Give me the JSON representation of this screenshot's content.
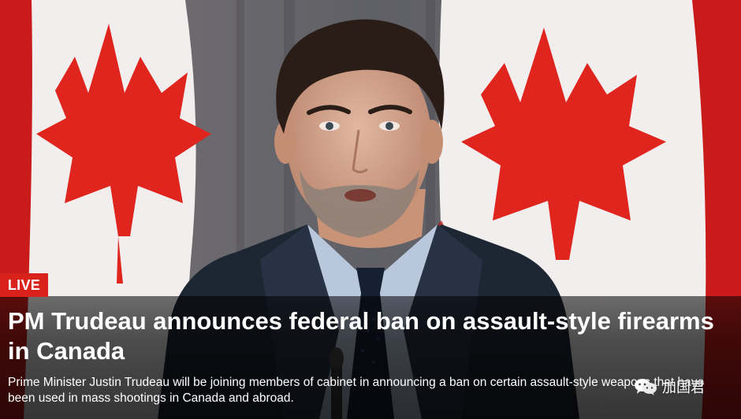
{
  "story": {
    "badge": "LIVE",
    "headline": "PM Trudeau announces federal ban on assault-style firearms in Canada",
    "dek": "Prime Minister Justin Trudeau will be joining members of cabinet in announcing a ban on certain assault-style weapons that have been used in mass shootings in Canada and abroad."
  },
  "watermark": {
    "text": "加国君",
    "icon": "wechat-icon"
  },
  "colors": {
    "badge": "#d9221b",
    "flag_red": "#e0241e",
    "suit": "#1d2633",
    "shirt": "#b9c7dc",
    "tie": "#152033"
  }
}
